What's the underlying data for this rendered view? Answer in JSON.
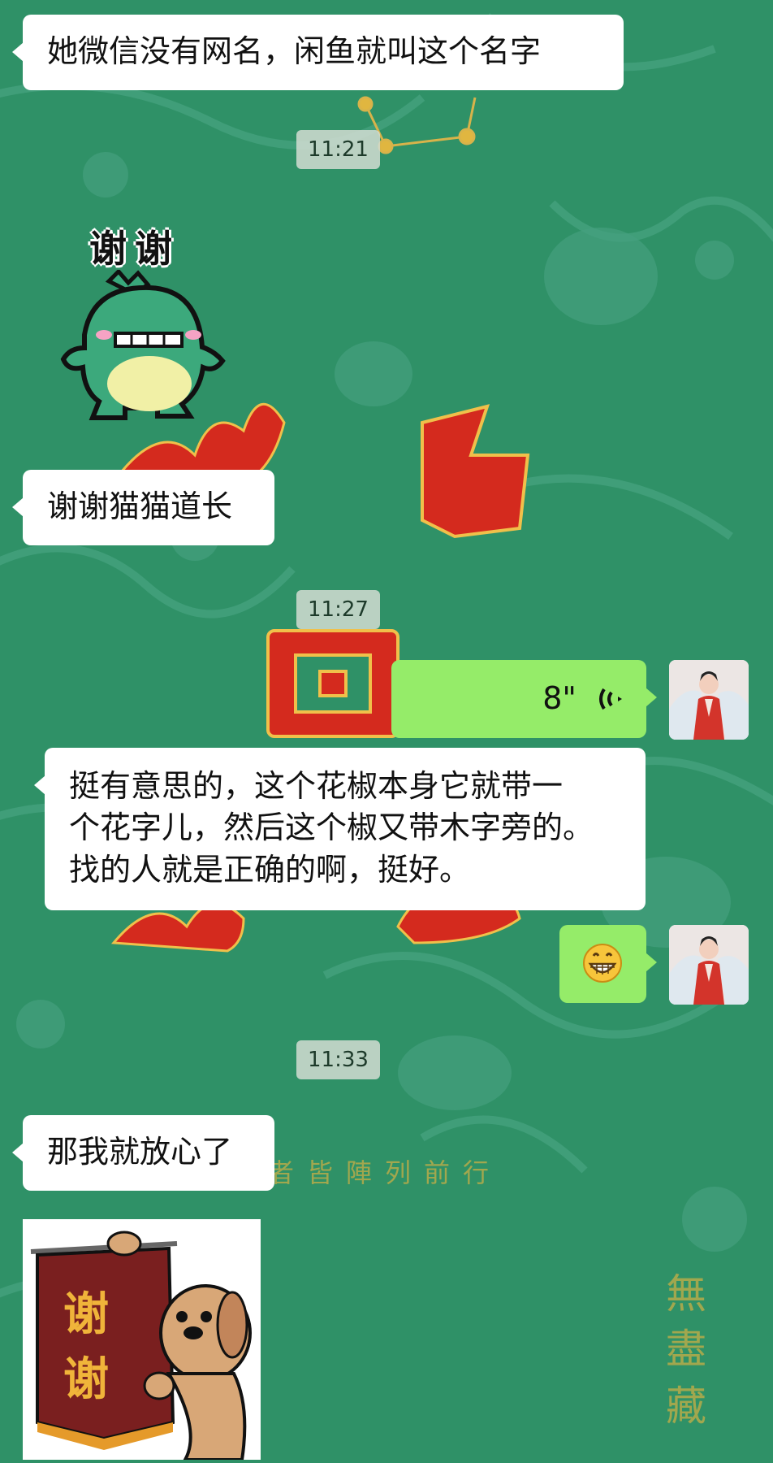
{
  "messages": {
    "m1": {
      "text": "她微信没有网名，闲鱼就叫这个名字"
    },
    "t1": {
      "text": "11:21"
    },
    "sticker1": {
      "text": "谢谢"
    },
    "m2": {
      "text": "谢谢猫猫道长"
    },
    "t2": {
      "text": "11:27"
    },
    "voice": {
      "duration": "8\""
    },
    "m3": {
      "line1": "挺有意思的，这个花椒本身它就带一",
      "line2": "个花字儿，然后这个椒又带木字旁的。",
      "line3": "找的人就是正确的啊，挺好。"
    },
    "emoji": {
      "icon": "grinning-face-icon"
    },
    "t3": {
      "text": "11:33"
    },
    "m4": {
      "text": "那我就放心了"
    },
    "sticker2": {
      "line1": "谢",
      "line2": "谢"
    }
  },
  "wallpaper": {
    "chars": [
      "飛",
      "回",
      "者皆陣列前行",
      "無",
      "盡",
      "藏"
    ]
  },
  "colors": {
    "background": "#2f9167",
    "bubble_in": "#ffffff",
    "bubble_out": "#95ec69",
    "wallpaper_red": "#d42a1e",
    "wallpaper_gold": "#c9ae4a"
  }
}
